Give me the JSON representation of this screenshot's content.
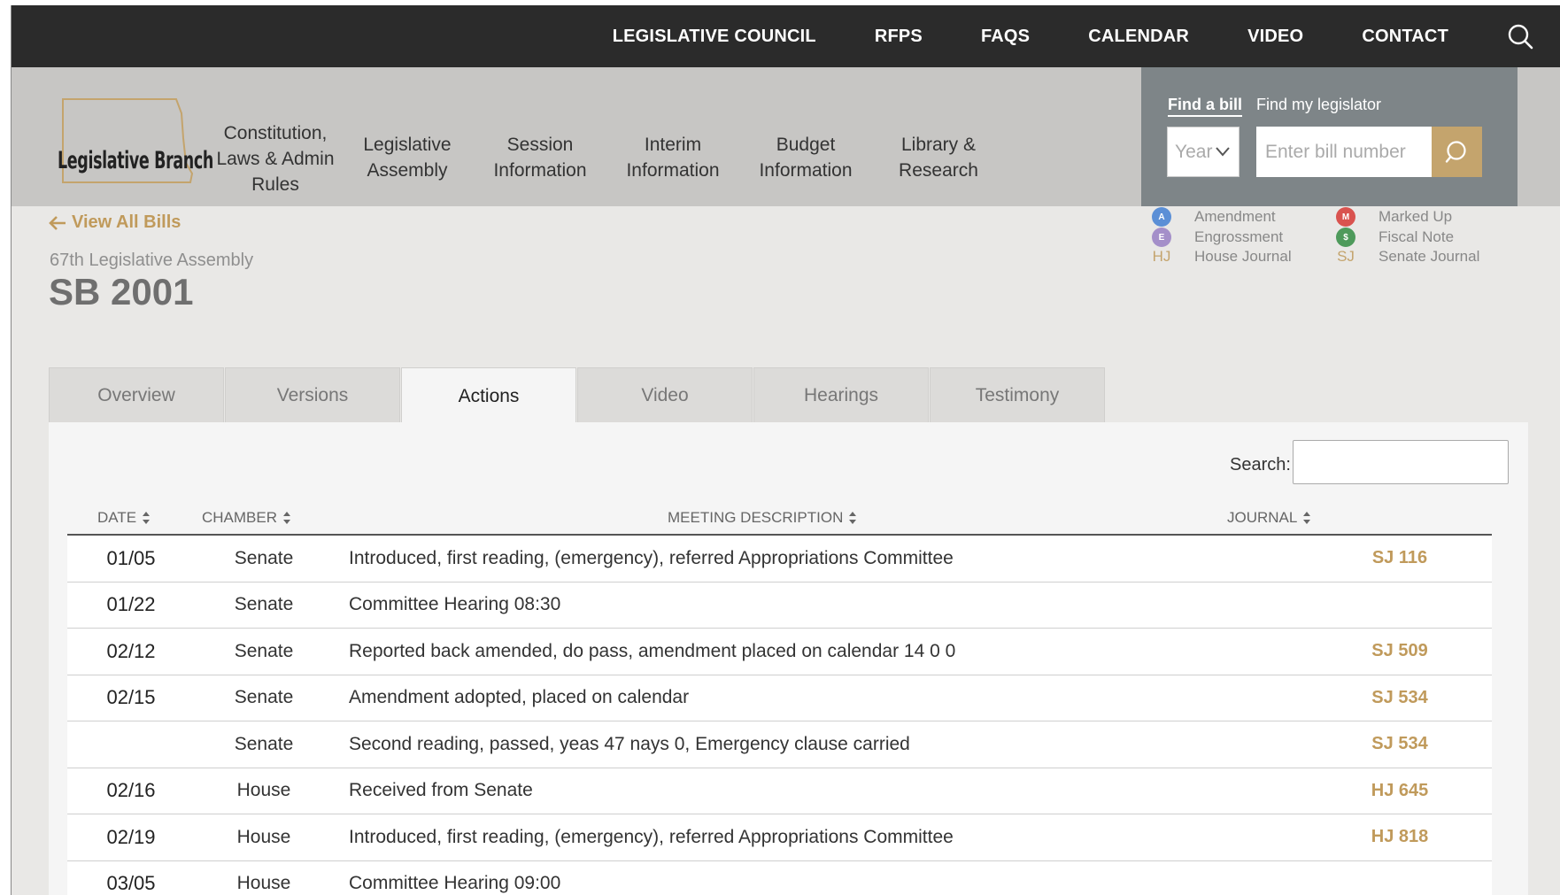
{
  "topnav": [
    {
      "label": "LEGISLATIVE COUNCIL",
      "name": "topnav-legislative-council"
    },
    {
      "label": "RFPS",
      "name": "topnav-rfps"
    },
    {
      "label": "FAQS",
      "name": "topnav-faqs"
    },
    {
      "label": "CALENDAR",
      "name": "topnav-calendar"
    },
    {
      "label": "VIDEO",
      "name": "topnav-video"
    },
    {
      "label": "CONTACT",
      "name": "topnav-contact"
    }
  ],
  "logo": {
    "text": "Legislative Branch"
  },
  "mainnav": [
    {
      "line1": "Constitution,",
      "line2": "Laws & Admin",
      "line3": "Rules"
    },
    {
      "line1": "Legislative",
      "line2": "Assembly",
      "line3": ""
    },
    {
      "line1": "Session",
      "line2": "Information",
      "line3": ""
    },
    {
      "line1": "Interim",
      "line2": "Information",
      "line3": ""
    },
    {
      "line1": "Budget",
      "line2": "Information",
      "line3": ""
    },
    {
      "line1": "Library &",
      "line2": "Research",
      "line3": ""
    }
  ],
  "finder": {
    "tab_bill": "Find a bill",
    "tab_legislator": "Find my legislator",
    "year_placeholder": "Year",
    "bill_placeholder": "Enter bill number"
  },
  "bill": {
    "back_label": "View All Bills",
    "assembly": "67th Legislative Assembly",
    "title": "SB 2001"
  },
  "legend": [
    {
      "badge": "A",
      "label": "Amendment",
      "color": "#5b8fd6"
    },
    {
      "badge": "E",
      "label": "Engrossment",
      "color": "#a48fc9"
    },
    {
      "badge": "HJ",
      "label": "House Journal",
      "color": ""
    },
    {
      "badge": "M",
      "label": "Marked Up",
      "color": "#d9534f"
    },
    {
      "badge": "$",
      "label": "Fiscal Note",
      "color": "#4e9a5b"
    },
    {
      "badge": "SJ",
      "label": "Senate Journal",
      "color": ""
    }
  ],
  "tabs": [
    "Overview",
    "Versions",
    "Actions",
    "Video",
    "Hearings",
    "Testimony"
  ],
  "active_tab": "Actions",
  "search": {
    "label": "Search:"
  },
  "table": {
    "headers": {
      "date": "DATE",
      "chamber": "CHAMBER",
      "description": "MEETING DESCRIPTION",
      "journal": "JOURNAL"
    },
    "rows": [
      {
        "date": "01/05",
        "chamber": "Senate",
        "description": "Introduced, first reading, (emergency), referred Appropriations Committee",
        "journal": "SJ 116"
      },
      {
        "date": "01/22",
        "chamber": "Senate",
        "description": "Committee Hearing 08:30",
        "journal": ""
      },
      {
        "date": "02/12",
        "chamber": "Senate",
        "description": "Reported back amended, do pass, amendment placed on calendar 14 0 0",
        "journal": "SJ 509"
      },
      {
        "date": "02/15",
        "chamber": "Senate",
        "description": "Amendment adopted, placed on calendar",
        "journal": "SJ 534"
      },
      {
        "date": "",
        "chamber": "Senate",
        "description": "Second reading, passed, yeas 47 nays 0, Emergency clause carried",
        "journal": "SJ 534"
      },
      {
        "date": "02/16",
        "chamber": "House",
        "description": "Received from Senate",
        "journal": "HJ 645"
      },
      {
        "date": "02/19",
        "chamber": "House",
        "description": "Introduced, first reading, (emergency), referred Appropriations Committee",
        "journal": "HJ 818"
      },
      {
        "date": "03/05",
        "chamber": "House",
        "description": "Committee Hearing 09:00",
        "journal": ""
      }
    ]
  }
}
